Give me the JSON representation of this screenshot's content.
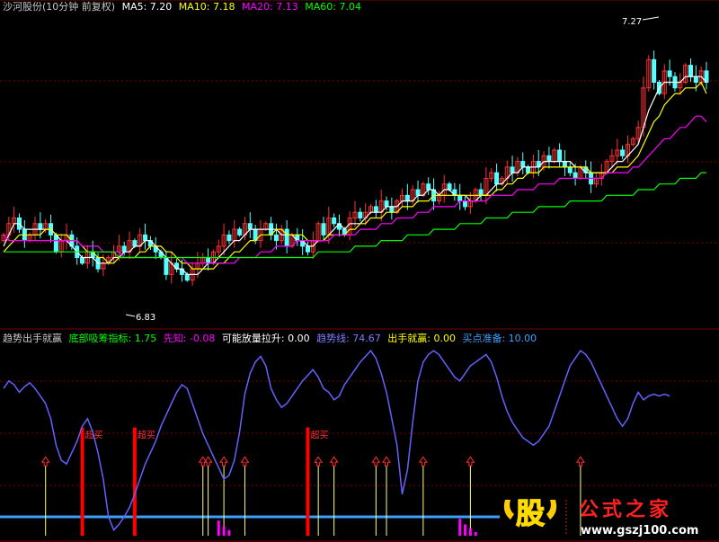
{
  "colors": {
    "background": "#000000",
    "grid": "#7a0000",
    "candle_up": "#ff3232",
    "candle_down": "#54ffff",
    "ma5": "#ffffff",
    "ma10": "#ffff00",
    "ma20": "#ff00ff",
    "ma60": "#00ff00",
    "trend": "#6262ff",
    "signal_red": "#ff0000",
    "signal_yellow": "#ffff80",
    "buy_line": "#3aa0ff",
    "ahead": "#ff00ff"
  },
  "top_header": {
    "title": "沙河股份(10分钟 前复权)",
    "ma5_label": "MA5: 7.20",
    "ma10_label": "MA10: 7.18",
    "ma20_label": "MA20: 7.13",
    "ma60_label": "MA60: 7.04"
  },
  "bottom_header": {
    "title": "趋势出手就赢",
    "dibu_label": "底部吸筹指标: 1.75",
    "xianzhi_label": "先知: -0.08",
    "kenengfang_label": "可能放量拉升: 0.00",
    "qushi_label": "趋势线: 74.67",
    "chushou_label": "出手就赢: 0.00",
    "maidian_label": "买点准备: 10.00"
  },
  "price_annotations": {
    "high": "7.27",
    "low": "6.83"
  },
  "signal_label": "超买",
  "watermark": {
    "stock_glyph": "股",
    "brand": "公式之家",
    "url": "www.gszj100.com"
  },
  "chart_data": [
    {
      "type": "candlestick",
      "title": "沙河股份(10分钟 前复权)",
      "ylim": [
        6.77,
        7.32
      ],
      "ylabel": "",
      "xlabel": "",
      "marked_high": 7.27,
      "marked_low": 6.83,
      "close_series": [
        6.93,
        6.95,
        6.96,
        6.94,
        6.92,
        6.93,
        6.95,
        6.94,
        6.95,
        6.93,
        6.9,
        6.92,
        6.93,
        6.91,
        6.89,
        6.88,
        6.9,
        6.89,
        6.87,
        6.88,
        6.89,
        6.9,
        6.91,
        6.9,
        6.92,
        6.91,
        6.93,
        6.92,
        6.91,
        6.9,
        6.89,
        6.86,
        6.88,
        6.87,
        6.86,
        6.85,
        6.87,
        6.88,
        6.89,
        6.88,
        6.9,
        6.91,
        6.93,
        6.92,
        6.94,
        6.93,
        6.95,
        6.94,
        6.92,
        6.94,
        6.95,
        6.93,
        6.92,
        6.94,
        6.91,
        6.93,
        6.92,
        6.91,
        6.9,
        6.92,
        6.95,
        6.93,
        6.96,
        6.95,
        6.94,
        6.93,
        6.96,
        6.97,
        6.96,
        6.97,
        6.98,
        6.97,
        6.99,
        6.98,
        6.97,
        6.99,
        7.0,
        6.99,
        7.01,
        7.0,
        7.02,
        7.01,
        6.99,
        7.0,
        7.02,
        7.01,
        7.0,
        6.99,
        6.98,
        6.99,
        7.01,
        7.0,
        7.03,
        7.04,
        7.02,
        7.03,
        7.05,
        7.04,
        7.06,
        7.05,
        7.04,
        7.06,
        7.05,
        7.07,
        7.06,
        7.08,
        7.06,
        7.05,
        7.04,
        7.03,
        7.05,
        7.04,
        7.02,
        7.03,
        7.04,
        7.06,
        7.07,
        7.08,
        7.07,
        7.09,
        7.1,
        7.12,
        7.19,
        7.24,
        7.2,
        7.18,
        7.22,
        7.21,
        7.19,
        7.2,
        7.23,
        7.21,
        7.2,
        7.22,
        7.2
      ],
      "series": [
        {
          "name": "MA5",
          "values": [
            6.91,
            6.93,
            6.95,
            6.95,
            6.94,
            6.94,
            6.94,
            6.94,
            6.94,
            6.94,
            6.93,
            6.92,
            6.92,
            6.91,
            6.9,
            6.89,
            6.89,
            6.89,
            6.88,
            6.88,
            6.88,
            6.89,
            6.89,
            6.9,
            6.9,
            6.91,
            6.91,
            6.92,
            6.92,
            6.91,
            6.9,
            6.89,
            6.88,
            6.87,
            6.87,
            6.86,
            6.86,
            6.86,
            6.87,
            6.88,
            6.88,
            6.89,
            6.9,
            6.91,
            6.92,
            6.92,
            6.93,
            6.94,
            6.94,
            6.94,
            6.94,
            6.94,
            6.94,
            6.93,
            6.93,
            6.93,
            6.92,
            6.92,
            6.91,
            6.91,
            6.92,
            6.92,
            6.93,
            6.94,
            6.95,
            6.94,
            6.95,
            6.95,
            6.95,
            6.96,
            6.97,
            6.97,
            6.97,
            6.98,
            6.98,
            6.98,
            6.99,
            6.99,
            6.99,
            7.0,
            7.0,
            7.01,
            7.01,
            7.0,
            7.01,
            7.01,
            7.0,
            7.0,
            7.0,
            6.99,
            6.99,
            7.0,
            7.0,
            7.01,
            7.02,
            7.02,
            7.03,
            7.04,
            7.04,
            7.05,
            7.05,
            7.05,
            7.05,
            7.06,
            7.06,
            7.06,
            7.06,
            7.06,
            7.06,
            7.05,
            7.05,
            7.04,
            7.04,
            7.04,
            7.04,
            7.04,
            7.05,
            7.06,
            7.06,
            7.07,
            7.08,
            7.09,
            7.12,
            7.15,
            7.17,
            7.19,
            7.2,
            7.2,
            7.2,
            7.2,
            7.21,
            7.21,
            7.21,
            7.21,
            7.2
          ]
        },
        {
          "name": "MA10",
          "values": [
            6.9,
            6.91,
            6.92,
            6.93,
            6.93,
            6.93,
            6.93,
            6.93,
            6.94,
            6.94,
            6.93,
            6.93,
            6.93,
            6.92,
            6.92,
            6.91,
            6.9,
            6.9,
            6.89,
            6.89,
            6.88,
            6.88,
            6.89,
            6.89,
            6.89,
            6.89,
            6.9,
            6.9,
            6.91,
            6.91,
            6.91,
            6.9,
            6.9,
            6.89,
            6.88,
            6.88,
            6.87,
            6.87,
            6.87,
            6.87,
            6.87,
            6.88,
            6.88,
            6.89,
            6.9,
            6.9,
            6.91,
            6.92,
            6.92,
            6.93,
            6.93,
            6.93,
            6.94,
            6.94,
            6.93,
            6.93,
            6.93,
            6.93,
            6.92,
            6.92,
            6.92,
            6.92,
            6.93,
            6.93,
            6.93,
            6.93,
            6.94,
            6.94,
            6.95,
            6.95,
            6.96,
            6.96,
            6.96,
            6.97,
            6.97,
            6.97,
            6.98,
            6.98,
            6.98,
            6.99,
            6.99,
            6.99,
            7.0,
            7.0,
            7.0,
            7.0,
            7.0,
            7.0,
            7.0,
            7.0,
            7.0,
            7.0,
            7.0,
            7.0,
            7.01,
            7.01,
            7.02,
            7.02,
            7.03,
            7.03,
            7.04,
            7.04,
            7.04,
            7.05,
            7.05,
            7.05,
            7.05,
            7.05,
            7.05,
            7.05,
            7.05,
            7.05,
            7.04,
            7.04,
            7.04,
            7.04,
            7.04,
            7.05,
            7.05,
            7.05,
            7.06,
            7.07,
            7.09,
            7.11,
            7.13,
            7.14,
            7.16,
            7.17,
            7.18,
            7.18,
            7.19,
            7.19,
            7.19,
            7.2,
            7.18
          ]
        },
        {
          "name": "MA20",
          "values": [
            6.93,
            6.92,
            6.92,
            6.92,
            6.92,
            6.92,
            6.92,
            6.92,
            6.92,
            6.92,
            6.92,
            6.92,
            6.92,
            6.92,
            6.92,
            6.91,
            6.91,
            6.91,
            6.91,
            6.9,
            6.9,
            6.9,
            6.9,
            6.89,
            6.89,
            6.89,
            6.89,
            6.89,
            6.89,
            6.89,
            6.89,
            6.89,
            6.89,
            6.89,
            6.89,
            6.88,
            6.88,
            6.88,
            6.88,
            6.88,
            6.88,
            6.88,
            6.88,
            6.88,
            6.88,
            6.89,
            6.89,
            6.89,
            6.89,
            6.9,
            6.9,
            6.9,
            6.91,
            6.91,
            6.91,
            6.91,
            6.92,
            6.92,
            6.92,
            6.92,
            6.92,
            6.92,
            6.92,
            6.93,
            6.93,
            6.93,
            6.93,
            6.93,
            6.94,
            6.94,
            6.94,
            6.94,
            6.95,
            6.95,
            6.95,
            6.96,
            6.96,
            6.96,
            6.96,
            6.97,
            6.97,
            6.97,
            6.98,
            6.98,
            6.98,
            6.98,
            6.98,
            6.99,
            6.99,
            6.99,
            6.99,
            6.99,
            6.99,
            7.0,
            7.0,
            7.0,
            7.0,
            7.0,
            7.01,
            7.01,
            7.01,
            7.01,
            7.02,
            7.02,
            7.02,
            7.02,
            7.03,
            7.03,
            7.03,
            7.03,
            7.03,
            7.03,
            7.03,
            7.03,
            7.03,
            7.04,
            7.04,
            7.04,
            7.04,
            7.04,
            7.05,
            7.05,
            7.06,
            7.07,
            7.08,
            7.09,
            7.1,
            7.1,
            7.11,
            7.12,
            7.12,
            7.13,
            7.14,
            7.14,
            7.13
          ]
        },
        {
          "name": "MA60",
          "values": [
            6.9,
            6.9,
            6.9,
            6.9,
            6.9,
            6.9,
            6.9,
            6.9,
            6.9,
            6.9,
            6.9,
            6.9,
            6.9,
            6.9,
            6.9,
            6.9,
            6.9,
            6.9,
            6.9,
            6.9,
            6.9,
            6.9,
            6.89,
            6.89,
            6.89,
            6.89,
            6.89,
            6.89,
            6.89,
            6.89,
            6.89,
            6.89,
            6.89,
            6.89,
            6.89,
            6.89,
            6.89,
            6.89,
            6.89,
            6.89,
            6.89,
            6.89,
            6.89,
            6.89,
            6.89,
            6.89,
            6.89,
            6.89,
            6.89,
            6.89,
            6.89,
            6.89,
            6.89,
            6.89,
            6.89,
            6.89,
            6.89,
            6.89,
            6.89,
            6.89,
            6.9,
            6.9,
            6.9,
            6.9,
            6.9,
            6.9,
            6.9,
            6.91,
            6.91,
            6.91,
            6.91,
            6.91,
            6.92,
            6.92,
            6.92,
            6.92,
            6.92,
            6.93,
            6.93,
            6.93,
            6.93,
            6.93,
            6.94,
            6.94,
            6.94,
            6.94,
            6.94,
            6.95,
            6.95,
            6.95,
            6.95,
            6.95,
            6.96,
            6.96,
            6.96,
            6.96,
            6.96,
            6.97,
            6.97,
            6.97,
            6.97,
            6.97,
            6.98,
            6.98,
            6.98,
            6.98,
            6.98,
            6.98,
            6.99,
            6.99,
            6.99,
            6.99,
            6.99,
            6.99,
            6.99,
            7.0,
            7.0,
            7.0,
            7.0,
            7.0,
            7.0,
            7.01,
            7.01,
            7.01,
            7.01,
            7.02,
            7.02,
            7.02,
            7.02,
            7.03,
            7.03,
            7.03,
            7.03,
            7.04,
            7.04
          ]
        }
      ]
    },
    {
      "type": "line",
      "title": "趋势出手就赢",
      "ylim": [
        0,
        100
      ],
      "xlabel": "",
      "ylabel": "",
      "series": [
        {
          "name": "趋势线",
          "values": [
            78,
            82,
            80,
            76,
            79,
            81,
            78,
            74,
            70,
            62,
            48,
            40,
            38,
            44,
            50,
            58,
            62,
            55,
            44,
            30,
            10,
            3,
            6,
            10,
            15,
            22,
            30,
            38,
            44,
            50,
            58,
            64,
            70,
            76,
            80,
            78,
            70,
            62,
            54,
            48,
            42,
            36,
            30,
            32,
            40,
            55,
            75,
            86,
            92,
            95,
            90,
            78,
            72,
            68,
            70,
            74,
            78,
            82,
            85,
            88,
            84,
            78,
            76,
            72,
            74,
            80,
            84,
            88,
            92,
            95,
            98,
            94,
            86,
            76,
            62,
            48,
            22,
            35,
            60,
            82,
            92,
            96,
            98,
            96,
            92,
            88,
            84,
            82,
            86,
            90,
            92,
            94,
            96,
            92,
            84,
            74,
            66,
            60,
            56,
            52,
            50,
            48,
            50,
            54,
            58,
            66,
            74,
            82,
            90,
            94,
            98,
            96,
            92,
            86,
            80,
            74,
            68,
            62,
            58,
            62,
            70,
            76,
            72,
            74,
            75,
            74,
            75,
            74
          ]
        },
        {
          "name": "买点准备",
          "values": [
            10,
            10,
            10,
            10,
            10,
            10,
            10,
            10,
            10,
            10,
            10,
            10,
            10,
            10,
            10,
            10,
            10,
            10,
            10,
            10,
            10,
            10,
            10,
            10,
            10,
            10,
            10,
            10,
            10,
            10,
            10,
            10,
            10,
            10,
            10,
            10,
            10,
            10,
            10,
            10,
            10,
            10,
            10,
            10,
            10,
            10,
            10,
            10,
            10,
            10,
            10,
            10,
            10,
            10,
            10,
            10,
            10,
            10,
            10,
            10,
            10,
            10,
            10,
            10,
            10,
            10,
            10,
            10,
            10,
            10,
            10,
            10,
            10,
            10,
            10,
            10,
            10,
            10,
            10,
            10,
            10,
            10,
            10,
            10,
            10,
            10,
            10,
            10,
            10,
            10,
            10,
            10,
            10,
            10,
            10,
            10,
            10,
            10,
            10,
            10,
            10,
            10,
            10,
            10,
            10,
            10,
            10,
            10,
            10,
            10,
            10,
            10,
            10,
            10,
            10,
            10,
            10,
            10,
            10,
            10,
            10,
            10,
            10,
            10,
            10,
            10,
            10,
            10
          ]
        }
      ],
      "current_values": {
        "底部吸筹指标": 1.75,
        "先知": -0.08,
        "可能放量拉升": 0.0,
        "趋势线": 74.67,
        "出手就赢": 0.0,
        "买点准备": 10.0
      },
      "red_signal_bars": [
        {
          "index": 15,
          "value": 45
        },
        {
          "index": 25,
          "value": 45
        },
        {
          "index": 58,
          "value": 45
        }
      ],
      "yellow_signal_bars": [
        {
          "index": 8,
          "value": 37
        },
        {
          "index": 38,
          "value": 37
        },
        {
          "index": 39,
          "value": 37
        },
        {
          "index": 42,
          "value": 37
        },
        {
          "index": 46,
          "value": 37
        },
        {
          "index": 60,
          "value": 37
        },
        {
          "index": 63,
          "value": 37
        },
        {
          "index": 71,
          "value": 37
        },
        {
          "index": 73,
          "value": 37
        },
        {
          "index": 80,
          "value": 37
        },
        {
          "index": 89,
          "value": 37
        },
        {
          "index": 110,
          "value": 37
        }
      ],
      "magenta_bars": [
        {
          "index": 41,
          "value": 8
        },
        {
          "index": 42,
          "value": 5
        },
        {
          "index": 43,
          "value": 3
        },
        {
          "index": 87,
          "value": 9
        },
        {
          "index": 88,
          "value": 6
        },
        {
          "index": 89,
          "value": 4
        },
        {
          "index": 90,
          "value": 2
        }
      ]
    }
  ]
}
